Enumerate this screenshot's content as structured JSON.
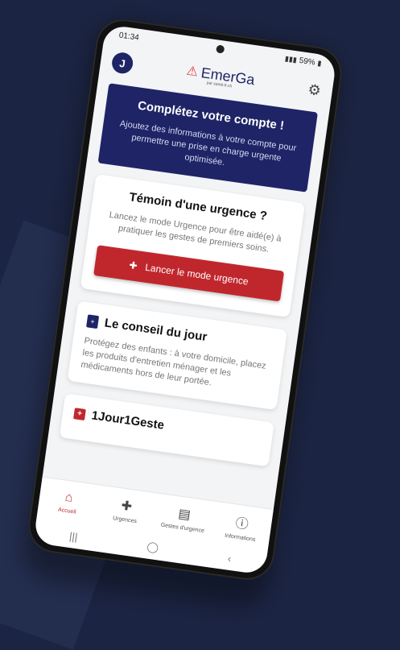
{
  "status_bar": {
    "time": "01:34",
    "battery": "59%"
  },
  "header": {
    "avatar_initial": "J",
    "logo_text": "EmerGa",
    "logo_subtitle": "par santé.fr.ch"
  },
  "complete_card": {
    "title": "Complétez votre compte !",
    "text": "Ajoutez des informations à votre compte pour permettre une prise en charge urgente optimisée."
  },
  "witness_card": {
    "title": "Témoin d'une urgence ?",
    "text": "Lancez le mode Urgence pour être aidé(e) à pratiquer les gestes de premiers soins.",
    "button_label": "Lancer le mode urgence"
  },
  "tip_card": {
    "title": "Le conseil du jour",
    "text": "Protégez des enfants : à votre domicile, placez les produits d'entretien ménager et les médicaments hors de leur portée."
  },
  "gesture_card": {
    "title": "1Jour1Geste"
  },
  "tabs": [
    {
      "label": "Accueil",
      "icon": "home-icon"
    },
    {
      "label": "Urgences",
      "icon": "medkit-icon"
    },
    {
      "label": "Gestes d'urgence",
      "icon": "book-icon"
    },
    {
      "label": "Informations",
      "icon": "info-icon"
    }
  ],
  "colors": {
    "primary": "#1e2466",
    "accent": "#c0272d",
    "background": "#1b2442"
  }
}
